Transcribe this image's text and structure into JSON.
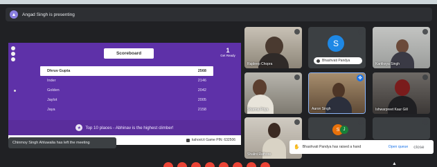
{
  "presenting": {
    "text": "Angad Singh is presenting",
    "icon": "present-icon"
  },
  "screen_share": {
    "scoreboard_title": "Scoreboard",
    "count_value": "1",
    "count_label": "Get Ready",
    "rows": [
      {
        "name": "Dhruv Gupta",
        "score": "2568"
      },
      {
        "name": "Inder",
        "score": "2146"
      },
      {
        "name": "Golden",
        "score": "2042"
      },
      {
        "name": "Jaylot",
        "score": "2005"
      },
      {
        "name": "Jaya",
        "score": "2158"
      }
    ],
    "banner_text": "Top 10 places - Abhinav is the highest climber!",
    "kahoot_text": "kahoot.it  Game PIN: 632506"
  },
  "toasts": {
    "left_text": "Chinmoy Singh Ahluwalia has left the meeting",
    "right_text": "Bhashvati Pandya has raised a hand",
    "right_action": "Open queue",
    "right_close": "close"
  },
  "tiles": [
    {
      "name": "Rajdeep Chopra"
    },
    {
      "name": "Bhashvati Pandya",
      "avatar_letter": "S"
    },
    {
      "name": "Kartikeya Singh"
    },
    {
      "name": "Sharma Priya"
    },
    {
      "name": "Aaron Singh"
    },
    {
      "name": "Ishwarpreet Kaur Gill"
    },
    {
      "name": "Shalini Rathore"
    },
    {
      "name": "",
      "avatar_letters": [
        "S",
        "J"
      ]
    },
    {
      "name": ""
    }
  ],
  "colors": {
    "app_bg": "#202124",
    "share_purple": "#5e31a8",
    "accent_blue": "#1a73e8",
    "end_call_red": "#ea4335"
  }
}
